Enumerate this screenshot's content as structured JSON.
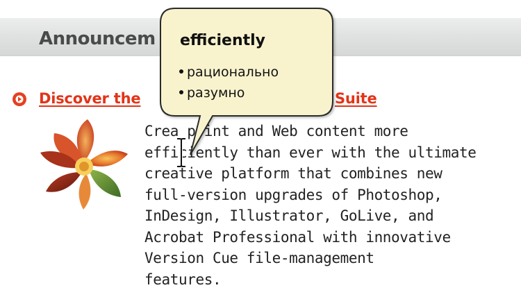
{
  "header": {
    "title": "Announcem"
  },
  "announcement": {
    "headline_left": "Discover the",
    "headline_right": "Suite",
    "body_lines": [
      "Crea   print and Web content more",
      "efficiently than ever with the ultimate",
      "creative platform that combines new",
      "full-version upgrades of Photoshop,",
      "InDesign, Illustrator, GoLive, and",
      "Acrobat Professional with innovative",
      "Version Cue file-management",
      "features."
    ]
  },
  "tooltip": {
    "word": "efficiently",
    "translations": [
      "рационально",
      "разумно"
    ]
  },
  "colors": {
    "link": "#e23418",
    "tooltip_bg": "#f8f3cd",
    "header_bg": "#dcdede"
  },
  "icons": {
    "bullet": "circle-arrow-right-icon",
    "cursor": "text-cursor-icon",
    "leaf": "adobe-leaf-logo"
  }
}
